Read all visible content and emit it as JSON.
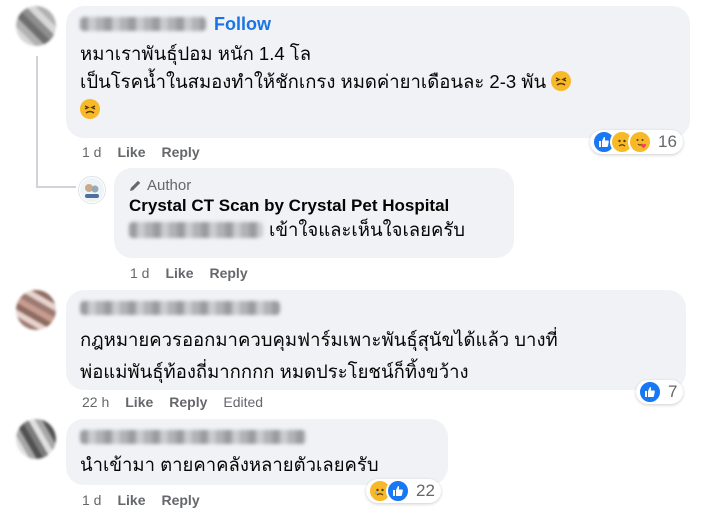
{
  "comments": [
    {
      "follow_label": "Follow",
      "lines": [
        "หมาเราพันธุ์ปอม หนัก 1.4 โล",
        "เป็นโรคน้ำในสมองทำให้ชักเกรง หมดค่ายาเดือนละ 2-3 พัน"
      ],
      "emoji": "tired-face",
      "time": "1 d",
      "like_label": "Like",
      "reply_label": "Reply",
      "reaction_count": "16",
      "reaction_icons": [
        "like",
        "sad",
        "care"
      ]
    },
    {
      "author_tag": "Author",
      "author_name": "Crystal CT Scan by Crystal Pet Hospital",
      "text": "เข้าใจและเห็นใจเลยครับ",
      "time": "1 d",
      "like_label": "Like",
      "reply_label": "Reply"
    },
    {
      "lines": [
        "กฎหมายควรออกมาควบคุมฟาร์มเพาะพันธุ์สุนัขได้แล้ว บางที่",
        "พ่อแม่พันธุ์ท้องถี่มากกกก หมดประโยชน์ก็ทิ้งขว้าง"
      ],
      "time": "22 h",
      "like_label": "Like",
      "reply_label": "Reply",
      "edited_label": "Edited",
      "reaction_count": "7",
      "reaction_icons": [
        "like"
      ]
    },
    {
      "text": "นำเข้ามา ตายคาคลังหลายตัวเลยครับ",
      "time": "1 d",
      "like_label": "Like",
      "reply_label": "Reply",
      "reaction_count": "22",
      "reaction_icons": [
        "sad",
        "like"
      ]
    }
  ],
  "colors": {
    "bubble": "#f0f2f5",
    "link": "#1b74e4",
    "meta": "#65676b",
    "like": "#1877f2"
  }
}
